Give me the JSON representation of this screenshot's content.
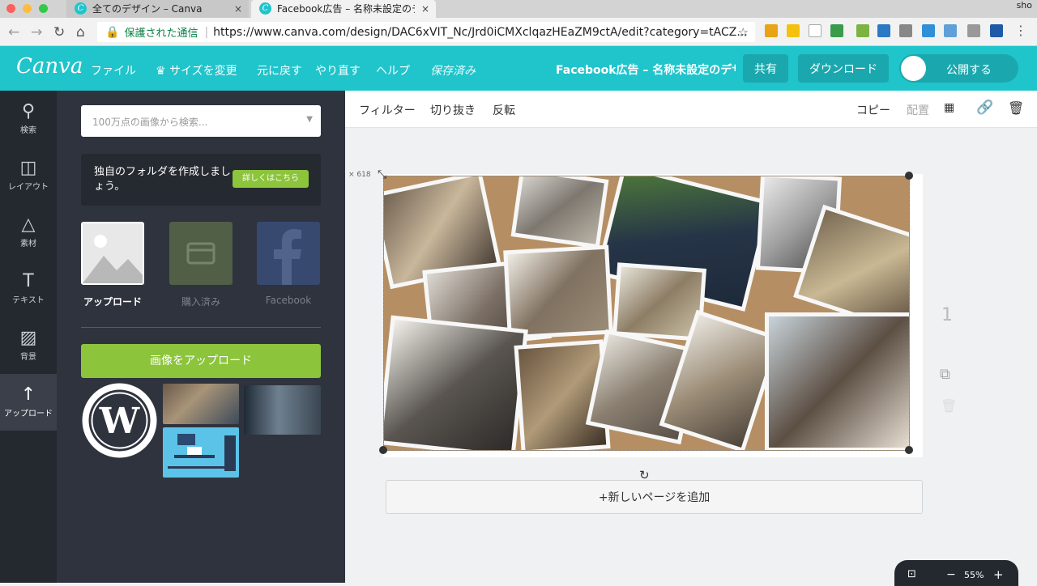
{
  "browser": {
    "tabs": [
      {
        "title": "全てのデザイン – Canva",
        "close": "×"
      },
      {
        "title": "Facebook広告 – 名称未設定のデザイン",
        "close": "×"
      }
    ],
    "user": "sho",
    "security_label": "保護された通信",
    "url": "https://www.canva.com/design/DAC6xVIT_Nc/Jrd0iCMXclqazHEaZM9ctA/edit?category=tACZ..."
  },
  "topbar": {
    "logo": "Canva",
    "file": "ファイル",
    "resize": "サイズを変更",
    "undo": "元に戻す",
    "redo": "やり直す",
    "help": "ヘルプ",
    "saved": "保存済み",
    "design_title": "Facebook広告 – 名称未設定のデザイン",
    "share": "共有",
    "download": "ダウンロード",
    "publish": "公開する"
  },
  "rail": {
    "search": "検索",
    "layout": "レイアウト",
    "elements": "素材",
    "text": "テキスト",
    "background": "背景",
    "uploads": "アップロード"
  },
  "panel": {
    "search_placeholder": "100万点の画像から検索...",
    "promo_text": "独自のフォルダを作成しましょう。",
    "promo_button": "詳しくはこちら",
    "sources": [
      "アップロード",
      "購入済み",
      "Facebook"
    ],
    "upload_button": "画像をアップロード"
  },
  "toolbar": {
    "filter": "フィルター",
    "crop": "切り抜き",
    "flip": "反転",
    "copy": "コピー",
    "arrange": "配置"
  },
  "canvas": {
    "size_label": "× 618",
    "add_page": "+新しいページを追加",
    "page_number": "1"
  },
  "zoom": {
    "minus": "−",
    "level": "55%",
    "plus": "+"
  }
}
